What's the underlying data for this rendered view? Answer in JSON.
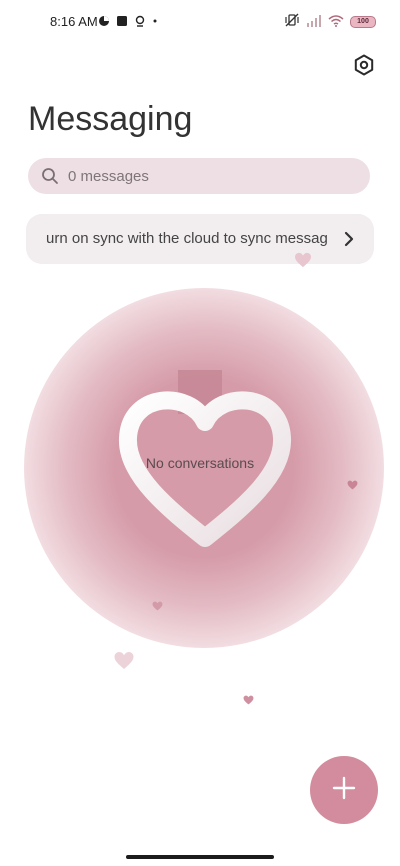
{
  "status_bar": {
    "time": "8:16 AM",
    "battery": "100"
  },
  "header": {
    "title": "Messaging",
    "settings_icon": "settings-hex-icon"
  },
  "search": {
    "placeholder": "0 messages"
  },
  "sync_banner": {
    "text": "urn on sync with the cloud to sync messag"
  },
  "empty_state": {
    "text": "No conversations"
  },
  "fab": {
    "icon": "plus-icon"
  },
  "colors": {
    "accent": "#d28c9d",
    "glow": "#d59ba8",
    "search_bg": "#eddfe3"
  }
}
